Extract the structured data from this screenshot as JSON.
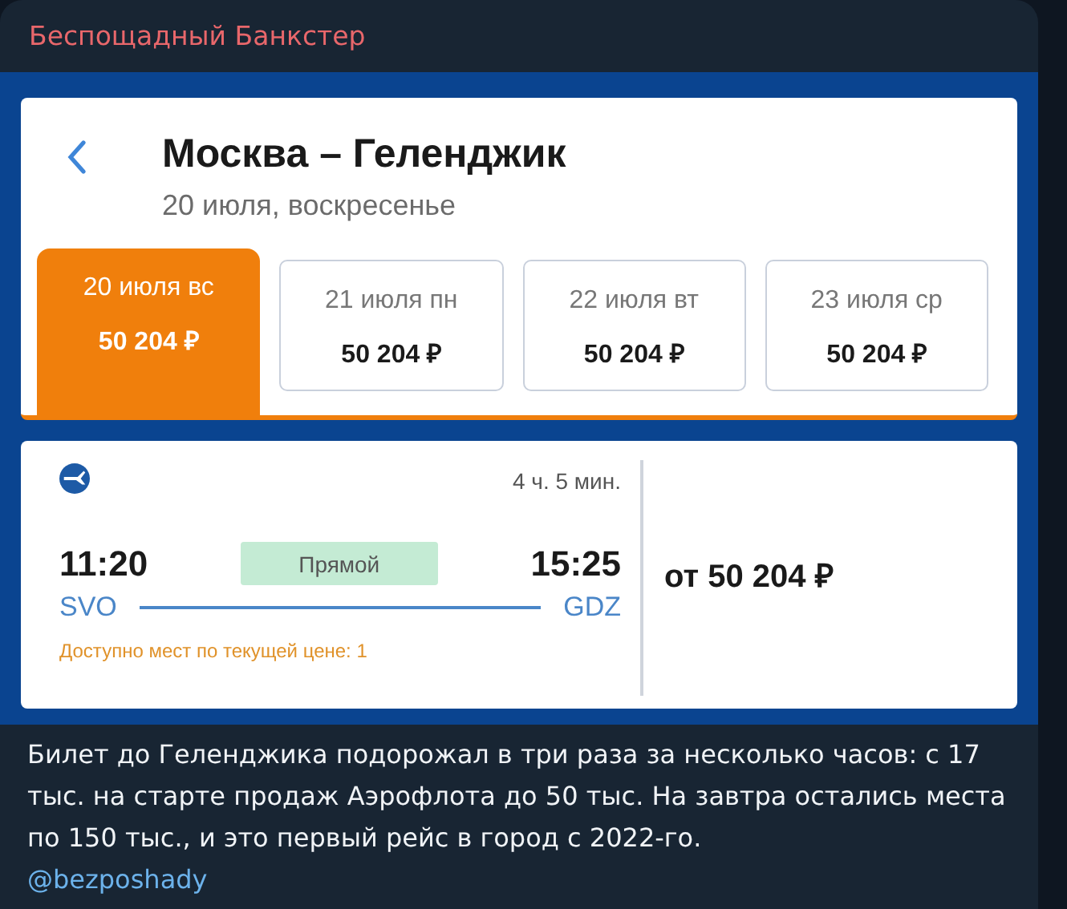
{
  "channel": {
    "name": "Беспощадный Банкстер"
  },
  "screenshot": {
    "route": {
      "title": "Москва – Геленджик",
      "date": "20 июля, воскресенье"
    },
    "dates": [
      {
        "label": "20 июля вс",
        "price": "50 204 ₽",
        "selected": true
      },
      {
        "label": "21 июля пн",
        "price": "50 204 ₽",
        "selected": false
      },
      {
        "label": "22 июля вт",
        "price": "50 204 ₽",
        "selected": false
      },
      {
        "label": "23 июля ср",
        "price": "50 204 ₽",
        "selected": false
      }
    ],
    "flight": {
      "duration": "4 ч. 5 мин.",
      "departure_time": "11:20",
      "badge": "Прямой",
      "arrival_time": "15:25",
      "from": "SVO",
      "to": "GDZ",
      "seats_note": "Доступно мест по текущей цене: 1",
      "price": "от 50 204 ₽"
    }
  },
  "post": {
    "text": "Билет до Геленджика подорожал в три раза за несколько часов: с 17 тыс. на старте продаж Аэрофлота до 50 тыс. На завтра остались места по 150 тыс., и это первый рейс в город с 2022-го.",
    "signature": "@bezposhady"
  }
}
